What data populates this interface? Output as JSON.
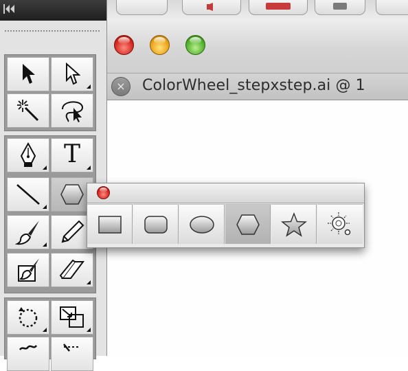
{
  "document": {
    "tab_title": "ColorWheel_stepxstep.ai @ 1",
    "close_glyph": "×"
  },
  "window_controls": [
    "close",
    "minimize",
    "zoom"
  ],
  "tools_panel": {
    "collapse_glyph": "◂◂",
    "groups": [
      [
        {
          "name": "selection-tool",
          "icon": "arrow-icon",
          "flyout": false
        },
        {
          "name": "direct-selection-tool",
          "icon": "hollow-arrow-icon",
          "flyout": true
        },
        {
          "name": "magic-wand-tool",
          "icon": "magic-wand-icon",
          "flyout": false
        },
        {
          "name": "lasso-tool",
          "icon": "lasso-icon",
          "flyout": false
        }
      ],
      [
        {
          "name": "pen-tool",
          "icon": "pen-nib-icon",
          "flyout": true
        },
        {
          "name": "type-tool",
          "icon": "type-icon",
          "label": "T",
          "flyout": true
        },
        {
          "name": "line-segment-tool",
          "icon": "line-icon",
          "flyout": true
        },
        {
          "name": "polygon-tool",
          "icon": "hexagon-icon",
          "flyout": true,
          "active": true
        },
        {
          "name": "paintbrush-tool",
          "icon": "brush-icon",
          "flyout": true
        },
        {
          "name": "pencil-tool",
          "icon": "pencil-icon",
          "flyout": true
        },
        {
          "name": "blob-brush-tool",
          "icon": "blob-brush-icon",
          "flyout": false
        },
        {
          "name": "eraser-tool",
          "icon": "eraser-icon",
          "flyout": true
        }
      ],
      [
        {
          "name": "rotate-tool",
          "icon": "rotate-icon",
          "flyout": true
        },
        {
          "name": "scale-tool",
          "icon": "scale-icon",
          "flyout": true
        }
      ]
    ]
  },
  "shape_flyout": {
    "tools": [
      {
        "name": "rectangle-tool",
        "icon": "rectangle-icon"
      },
      {
        "name": "rounded-rectangle-tool",
        "icon": "rounded-rectangle-icon"
      },
      {
        "name": "ellipse-tool",
        "icon": "ellipse-icon"
      },
      {
        "name": "polygon-tool",
        "icon": "hexagon-icon",
        "active": true
      },
      {
        "name": "star-tool",
        "icon": "star-icon"
      },
      {
        "name": "flare-tool",
        "icon": "flare-icon"
      }
    ]
  },
  "colors": {
    "panel_bg": "#e3e3e3",
    "panel_header": "#2a2a2a",
    "close_red": "#d3261d",
    "minimize_yellow": "#eaa116",
    "zoom_green": "#4fae2a"
  }
}
